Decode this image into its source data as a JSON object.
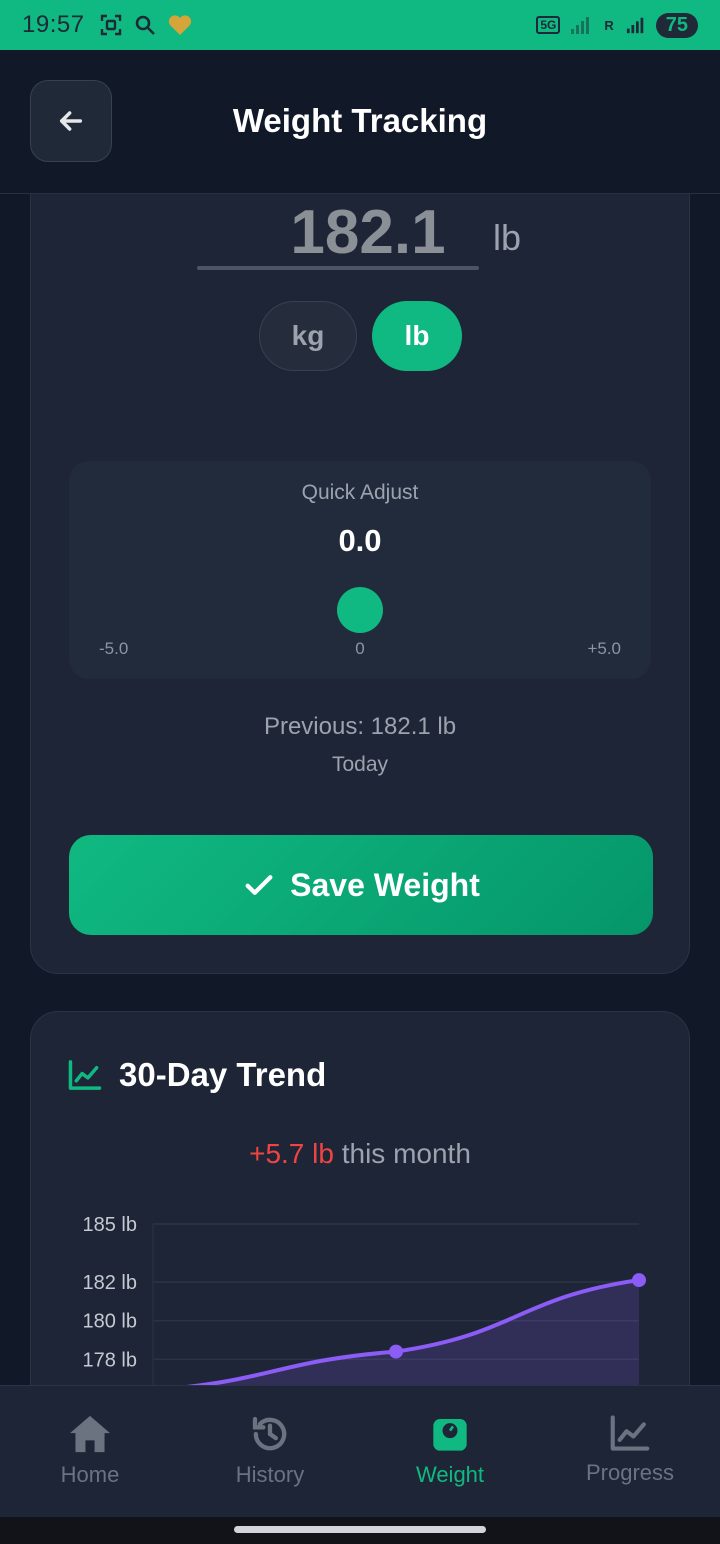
{
  "status_bar": {
    "time": "19:57",
    "network_tag": "5G",
    "sim_tag": "R",
    "battery": "75"
  },
  "header": {
    "title": "Weight Tracking"
  },
  "weight_entry": {
    "value": "182.1",
    "unit": "lb",
    "units": [
      "kg",
      "lb"
    ],
    "selected_unit": "lb"
  },
  "quick_adjust": {
    "label": "Quick Adjust",
    "value": "0.0",
    "min_label": "-5.0",
    "mid_label": "0",
    "max_label": "+5.0",
    "level": 0.5
  },
  "previous": {
    "text": "Previous: 182.1 lb",
    "date": "Today"
  },
  "save_button": {
    "label": "Save Weight"
  },
  "trend": {
    "title": "30-Day Trend",
    "change": "+5.7 lb",
    "change_suffix": " this month"
  },
  "chart_data": {
    "type": "line",
    "y_ticks": [
      "185 lb",
      "182 lb",
      "180 lb",
      "178 lb"
    ],
    "y_tick_values": [
      185,
      182,
      180,
      178
    ],
    "ylim": [
      176,
      185
    ],
    "points": [
      {
        "x": 0.0,
        "y": 176.4
      },
      {
        "x": 0.5,
        "y": 178.4
      },
      {
        "x": 1.0,
        "y": 182.1
      }
    ],
    "marked_points": [
      1,
      2
    ],
    "line_color": "#8b5cf6",
    "grid": true
  },
  "nav": {
    "items": [
      {
        "label": "Home",
        "icon": "home-icon"
      },
      {
        "label": "History",
        "icon": "history-icon"
      },
      {
        "label": "Weight",
        "icon": "scale-icon"
      },
      {
        "label": "Progress",
        "icon": "chart-line-icon"
      }
    ],
    "active": "Weight"
  },
  "colors": {
    "accent": "#10b981",
    "negative": "#ef4444",
    "chart_line": "#8b5cf6"
  }
}
